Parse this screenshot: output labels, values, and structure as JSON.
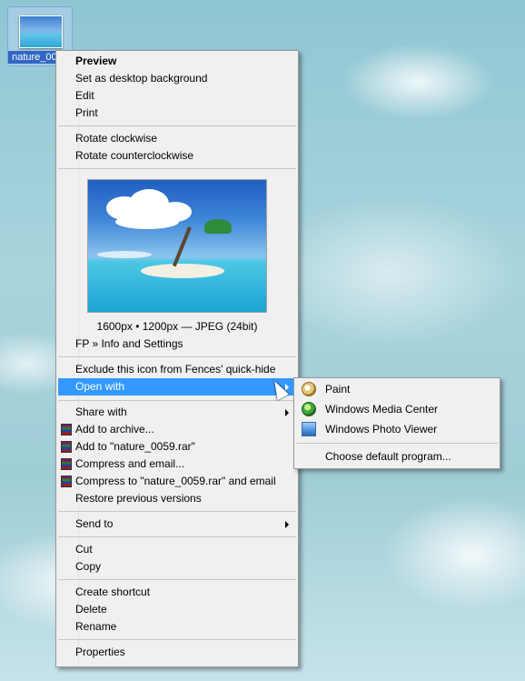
{
  "desktop": {
    "icon_label": "nature_0059"
  },
  "context_menu": {
    "preview": "Preview",
    "set_background": "Set as desktop background",
    "edit": "Edit",
    "print": "Print",
    "rotate_cw": "Rotate clockwise",
    "rotate_ccw": "Rotate counterclockwise",
    "image_info": "1600px • 1200px — JPEG (24bit)",
    "fp_settings": "FP » Info and Settings",
    "exclude_fences": "Exclude this icon from Fences' quick-hide",
    "open_with": "Open with",
    "share_with": "Share with",
    "add_archive": "Add to archive...",
    "add_rar": "Add to \"nature_0059.rar\"",
    "compress_email": "Compress and email...",
    "compress_rar_email": "Compress to \"nature_0059.rar\" and email",
    "restore_versions": "Restore previous versions",
    "send_to": "Send to",
    "cut": "Cut",
    "copy": "Copy",
    "create_shortcut": "Create shortcut",
    "delete": "Delete",
    "rename": "Rename",
    "properties": "Properties"
  },
  "open_with_submenu": {
    "paint": "Paint",
    "wmc": "Windows Media Center",
    "wpv": "Windows Photo Viewer",
    "choose_default": "Choose default program..."
  },
  "icons": {
    "rar": "winrar-archive-icon",
    "paint": "paint-icon",
    "wmc": "windows-media-center-icon",
    "wpv": "windows-photo-viewer-icon"
  },
  "colors": {
    "highlight": "#3399ff",
    "menu_bg": "#f0f0f0"
  }
}
